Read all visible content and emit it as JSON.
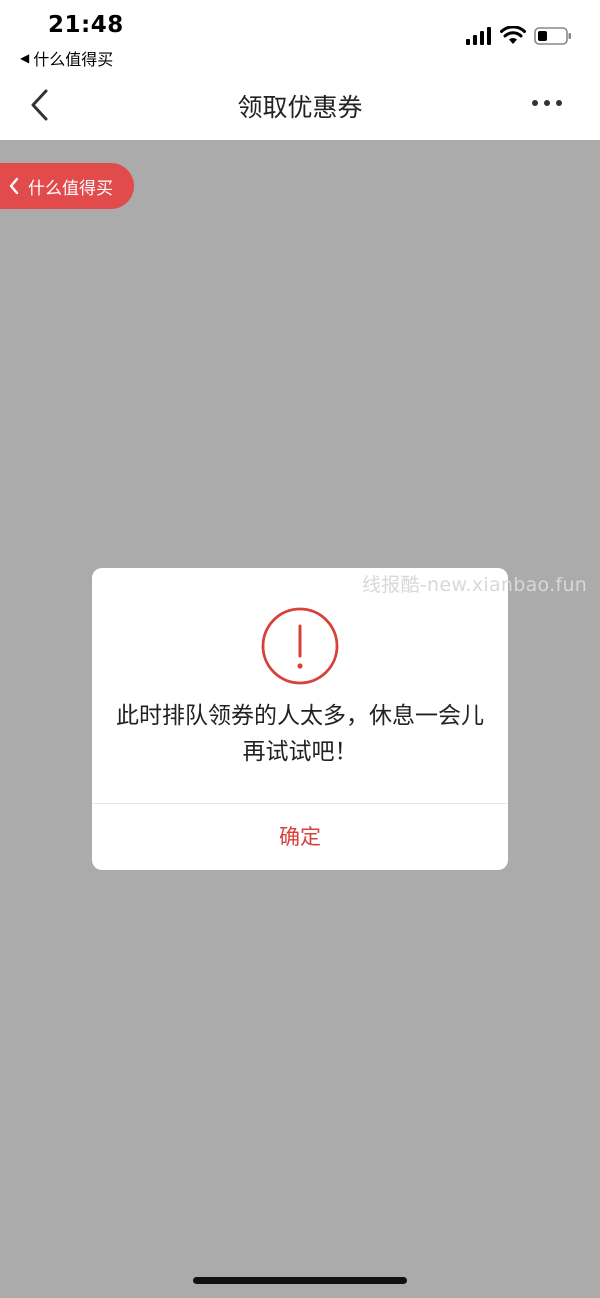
{
  "status_bar": {
    "time": "21:48",
    "back_app_label": "什么值得买"
  },
  "nav": {
    "title": "领取优惠券"
  },
  "float_back": {
    "label": "什么值得买"
  },
  "watermark": "线报酷-new.xianbao.fun",
  "dialog": {
    "message": "此时排队领券的人太多，休息一会儿再试试吧！",
    "confirm_label": "确定"
  },
  "colors": {
    "accent": "#e24b4b",
    "overlay": "#ababab"
  }
}
